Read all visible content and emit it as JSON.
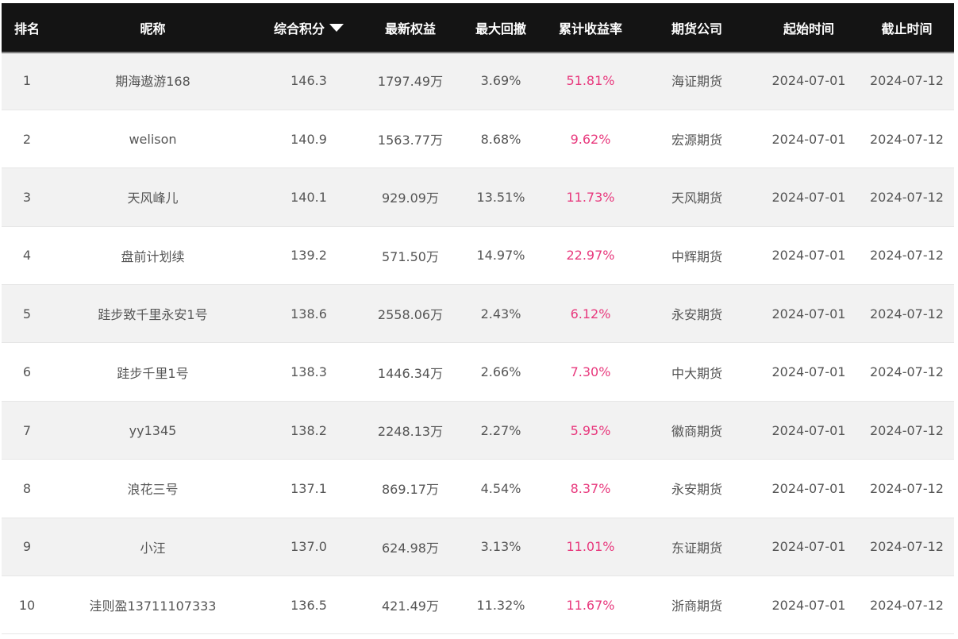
{
  "header": {
    "rank": "排名",
    "nickname": "昵称",
    "score": "综合积分",
    "equity": "最新权益",
    "drawdown": "最大回撤",
    "return_rate": "累计收益率",
    "company": "期货公司",
    "start": "起始时间",
    "end": "截止时间"
  },
  "sort": {
    "column": "score",
    "direction": "desc",
    "icon": "triangle-down-icon"
  },
  "colors": {
    "header_bg": "#141414",
    "profit": "#e8397d",
    "row_alt": "#f2f2f2"
  },
  "rows": [
    {
      "rank": "1",
      "nickname": "期海遨游168",
      "score": "146.3",
      "equity": "1797.49万",
      "drawdown": "3.69%",
      "return_rate": "51.81%",
      "company": "海证期货",
      "start": "2024-07-01",
      "end": "2024-07-12"
    },
    {
      "rank": "2",
      "nickname": "welison",
      "score": "140.9",
      "equity": "1563.77万",
      "drawdown": "8.68%",
      "return_rate": "9.62%",
      "company": "宏源期货",
      "start": "2024-07-01",
      "end": "2024-07-12"
    },
    {
      "rank": "3",
      "nickname": "天风峰儿",
      "score": "140.1",
      "equity": "929.09万",
      "drawdown": "13.51%",
      "return_rate": "11.73%",
      "company": "天风期货",
      "start": "2024-07-01",
      "end": "2024-07-12"
    },
    {
      "rank": "4",
      "nickname": "盘前计划续",
      "score": "139.2",
      "equity": "571.50万",
      "drawdown": "14.97%",
      "return_rate": "22.97%",
      "company": "中辉期货",
      "start": "2024-07-01",
      "end": "2024-07-12"
    },
    {
      "rank": "5",
      "nickname": "跬步致千里永安1号",
      "score": "138.6",
      "equity": "2558.06万",
      "drawdown": "2.43%",
      "return_rate": "6.12%",
      "company": "永安期货",
      "start": "2024-07-01",
      "end": "2024-07-12"
    },
    {
      "rank": "6",
      "nickname": "跬步千里1号",
      "score": "138.3",
      "equity": "1446.34万",
      "drawdown": "2.66%",
      "return_rate": "7.30%",
      "company": "中大期货",
      "start": "2024-07-01",
      "end": "2024-07-12"
    },
    {
      "rank": "7",
      "nickname": "yy1345",
      "score": "138.2",
      "equity": "2248.13万",
      "drawdown": "2.27%",
      "return_rate": "5.95%",
      "company": "徽商期货",
      "start": "2024-07-01",
      "end": "2024-07-12"
    },
    {
      "rank": "8",
      "nickname": "浪花三号",
      "score": "137.1",
      "equity": "869.17万",
      "drawdown": "4.54%",
      "return_rate": "8.37%",
      "company": "永安期货",
      "start": "2024-07-01",
      "end": "2024-07-12"
    },
    {
      "rank": "9",
      "nickname": "小汪",
      "score": "137.0",
      "equity": "624.98万",
      "drawdown": "3.13%",
      "return_rate": "11.01%",
      "company": "东证期货",
      "start": "2024-07-01",
      "end": "2024-07-12"
    },
    {
      "rank": "10",
      "nickname": "洼则盈13711107333",
      "score": "136.5",
      "equity": "421.49万",
      "drawdown": "11.32%",
      "return_rate": "11.67%",
      "company": "浙商期货",
      "start": "2024-07-01",
      "end": "2024-07-12"
    }
  ]
}
